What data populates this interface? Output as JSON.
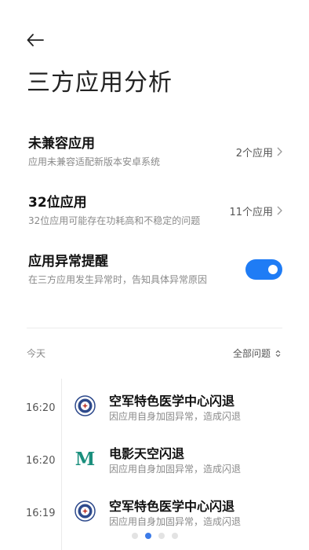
{
  "header": {
    "title": "三方应用分析"
  },
  "settings": [
    {
      "name": "未兼容应用",
      "desc": "应用未兼容适配新版本安卓系统",
      "value": "2个应用"
    },
    {
      "name": "32位应用",
      "desc": "32位应用可能存在功耗高和不稳定的问题",
      "value": "11个应用"
    },
    {
      "name": "应用异常提醒",
      "desc": "在三方应用发生异常时，告知具体异常原因",
      "enabled": true
    }
  ],
  "list": {
    "section_label": "今天",
    "filter_label": "全部问题",
    "events": [
      {
        "time": "16:20",
        "app": "空军特色医学中心闪退",
        "reason": "因应用自身加固异常，造成闪退",
        "icon": "hospital-emblem-icon"
      },
      {
        "time": "16:20",
        "app": "电影天空闪退",
        "reason": "因应用自身加固异常，造成闪退",
        "icon": "letter-m-icon",
        "icon_color": "#1a8f7d"
      },
      {
        "time": "16:19",
        "app": "空军特色医学中心闪退",
        "reason": "因应用自身加固异常，造成闪退",
        "icon": "hospital-emblem-icon"
      }
    ]
  },
  "pager": {
    "count": 4,
    "active": 1
  },
  "colors": {
    "accent": "#1f7cf5"
  }
}
